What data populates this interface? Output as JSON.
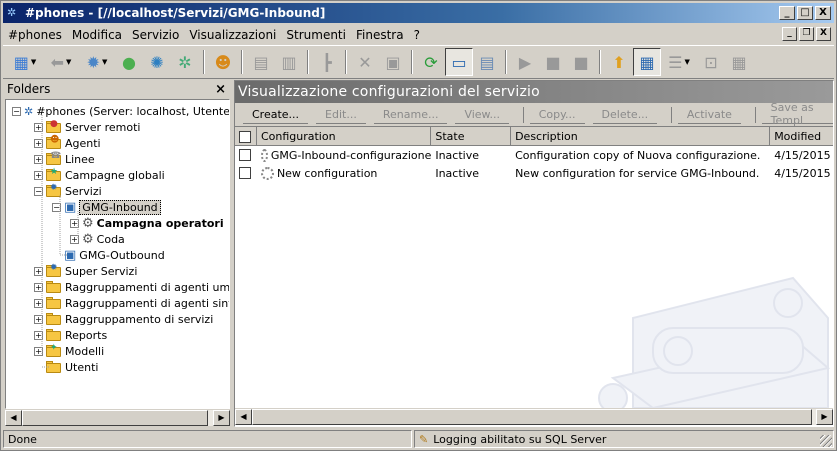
{
  "window": {
    "title": "#phones - [//localhost/Servizi/GMG-Inbound]",
    "controls": {
      "minimize": "_",
      "maximize": "□",
      "close": "X"
    }
  },
  "menubar": {
    "items": [
      {
        "label": "#phones",
        "mnemonic": "#"
      },
      {
        "label": "Modifica",
        "mnemonic": "M"
      },
      {
        "label": "Servizio",
        "mnemonic": "S"
      },
      {
        "label": "Visualizzazioni",
        "mnemonic": "V"
      },
      {
        "label": "Strumenti",
        "mnemonic": "S"
      },
      {
        "label": "Finestra",
        "mnemonic": "F"
      },
      {
        "label": "?",
        "mnemonic": "?"
      }
    ],
    "mdi_controls": {
      "minimize": "_",
      "restore": "❐",
      "close": "X"
    }
  },
  "folders": {
    "title": "Folders",
    "close": "×",
    "tree": [
      {
        "label": "#phones (Server: localhost, Utente: a",
        "level": 0,
        "toggle": "−"
      },
      {
        "label": "Server remoti",
        "level": 1,
        "toggle": "+"
      },
      {
        "label": "Agenti",
        "level": 1,
        "toggle": "+"
      },
      {
        "label": "Linee",
        "level": 1,
        "toggle": "+"
      },
      {
        "label": "Campagne globali",
        "level": 1,
        "toggle": "+"
      },
      {
        "label": "Servizi",
        "level": 1,
        "toggle": "−"
      },
      {
        "label": "GMG-Inbound",
        "level": 2,
        "toggle": "−",
        "selected": true
      },
      {
        "label": "Campagna operatori",
        "level": 3,
        "toggle": "+",
        "bold": true
      },
      {
        "label": "Coda",
        "level": 3,
        "toggle": "+"
      },
      {
        "label": "GMG-Outbound",
        "level": 2,
        "toggle": ""
      },
      {
        "label": "Super Servizi",
        "level": 1,
        "toggle": "+"
      },
      {
        "label": "Raggruppamenti di agenti umani",
        "level": 1,
        "toggle": "+"
      },
      {
        "label": "Raggruppamenti di agenti sintetic",
        "level": 1,
        "toggle": "+"
      },
      {
        "label": "Raggruppamento di servizi",
        "level": 1,
        "toggle": "+"
      },
      {
        "label": "Reports",
        "level": 1,
        "toggle": "+"
      },
      {
        "label": "Modelli",
        "level": 1,
        "toggle": "+"
      },
      {
        "label": "Utenti",
        "level": 1,
        "toggle": ""
      }
    ]
  },
  "panel": {
    "title": "Visualizzazione configurazioni del servizio",
    "actions": [
      {
        "label": "Create...",
        "enabled": true
      },
      {
        "label": "Edit...",
        "enabled": false
      },
      {
        "label": "Rename...",
        "enabled": false
      },
      {
        "label": "View...",
        "enabled": false
      },
      {
        "label": "Copy...",
        "enabled": false
      },
      {
        "label": "Delete...",
        "enabled": false
      },
      {
        "label": "Activate",
        "enabled": false
      },
      {
        "label": "Save as Templ",
        "enabled": false
      }
    ],
    "columns": [
      "Configuration",
      "State",
      "Description",
      "Modified"
    ],
    "rows": [
      {
        "configuration": "GMG-Inbound-configurazione",
        "state": "Inactive",
        "description": "Configuration copy of Nuova configurazione.",
        "modified": "4/15/2015"
      },
      {
        "configuration": "New configuration",
        "state": "Inactive",
        "description": "New configuration for service GMG-Inbound.",
        "modified": "4/15/2015"
      }
    ]
  },
  "statusbar": {
    "left": "Done",
    "logging": "Logging abilitato su SQL Server"
  }
}
